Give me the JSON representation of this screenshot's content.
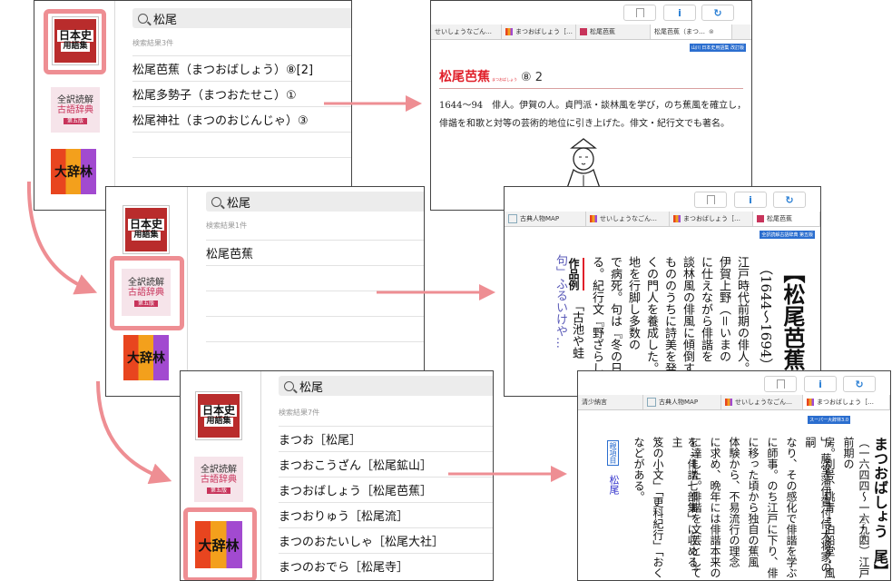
{
  "icons": {
    "nihonshi": {
      "line1": "日本史",
      "line2": "用語集"
    },
    "kogo": {
      "line1": "全訳読解",
      "line2": "古語辞典",
      "line3": "第五版"
    },
    "daijirin": {
      "text": "大辞林"
    }
  },
  "colors": {
    "highlight": "#ee8e93",
    "arrow": "#ee8e93",
    "link_blue": "#2a7fd4",
    "headword_red": "#e0202a"
  },
  "toolbar": {
    "bookmark_icon": "bookmark-icon",
    "info_label": "i",
    "refresh_icon": "refresh-icon"
  },
  "panel1": {
    "query": "松尾",
    "count": "検索結果3件",
    "results": [
      {
        "label": "松尾芭蕉（まつおばしょう）⑧[2]"
      },
      {
        "label": "松尾多勢子（まつおたせこ）①"
      },
      {
        "label": "松尾神社（まつのおじんじゃ）③"
      }
    ]
  },
  "panel2": {
    "query": "松尾",
    "count": "検索結果1件",
    "results": [
      {
        "label": "松尾芭蕉"
      }
    ]
  },
  "panel3": {
    "query": "松尾",
    "count": "検索結果7件",
    "results": [
      {
        "label": "まつお［松尾］"
      },
      {
        "label": "まつおこうざん［松尾鉱山］"
      },
      {
        "label": "まつおばしょう［松尾芭蕉］"
      },
      {
        "label": "まつおりゅう［松尾流］"
      },
      {
        "label": "まつのおたいしゃ［松尾大社］"
      },
      {
        "label": "まつのおでら［松尾寺］"
      }
    ]
  },
  "detail1": {
    "tabs": [
      "せいしょうなごん…",
      "まつおばしょう［…",
      "松尾芭蕉",
      "松尾芭蕉（まつ…"
    ],
    "badge": "山川 日本史用語集 改訂版",
    "headword": "松尾芭蕉",
    "ruby": "まつおばしょう",
    "freq": "⑧ 2",
    "line1": "1644〜94　俳人。伊賀の人。貞門派・談林風を学び，のち蕉風を確立し，",
    "line2": "俳諧を和歌と対等の芸術的地位に引き上げた。俳文・紀行文でも著名。"
  },
  "detail2": {
    "tabs": [
      "古典人物MAP",
      "せいしょうなごん…",
      "まつおばしょう［…",
      "松尾芭蕉"
    ],
    "badge": "全訳読解古語辞典 第五版",
    "headword": "【松尾芭蕉】",
    "years": "（1644〜1694）",
    "cols": [
      "江戸時代前期の俳人。",
      "伊賀上野（＝いまの",
      "に仕えながら俳諧を",
      "談林風の俳風に傾倒す",
      "もののうちに詩美を発",
      "くの門人を養成した。",
      "地を行脚し多数の",
      "で病死。句は『冬の日",
      "る。紀行文『野ざらし"
    ],
    "sample_label": "作品例",
    "sample1": "「古池や蛙",
    "sample2": "句」ふるいけや…"
  },
  "detail3": {
    "tabs": [
      "清少納言",
      "古典人物MAP",
      "せいしょうなごん…",
      "まつおばしょう［…"
    ],
    "badge": "スーパー大辞林3.0",
    "headword": "まつおばしょう",
    "headword_kanji": "【松尾】",
    "ruby": "まつを ばせう",
    "cols": [
      "（一六四四〜一六九四）江戸前期の",
      "房。別号、桃青・泊船堂・風",
      "」。藤堂藩伊賀付侍大将家の嗣",
      "なり、その感化で俳諧を学ぶ",
      "に師事。のち江戸に下り、俳",
      "に移った頃から独自の蕉風",
      "体験から、不易流行の理念",
      "に求め、晩年には俳諧本来の",
      "に達した。俳諧を文芸として",
      "を「俳諧七部集」に収める。主",
      "笈の小文」「更科紀行」「おく",
      "などがある。"
    ],
    "related_label": "親項目",
    "related": "松尾"
  }
}
